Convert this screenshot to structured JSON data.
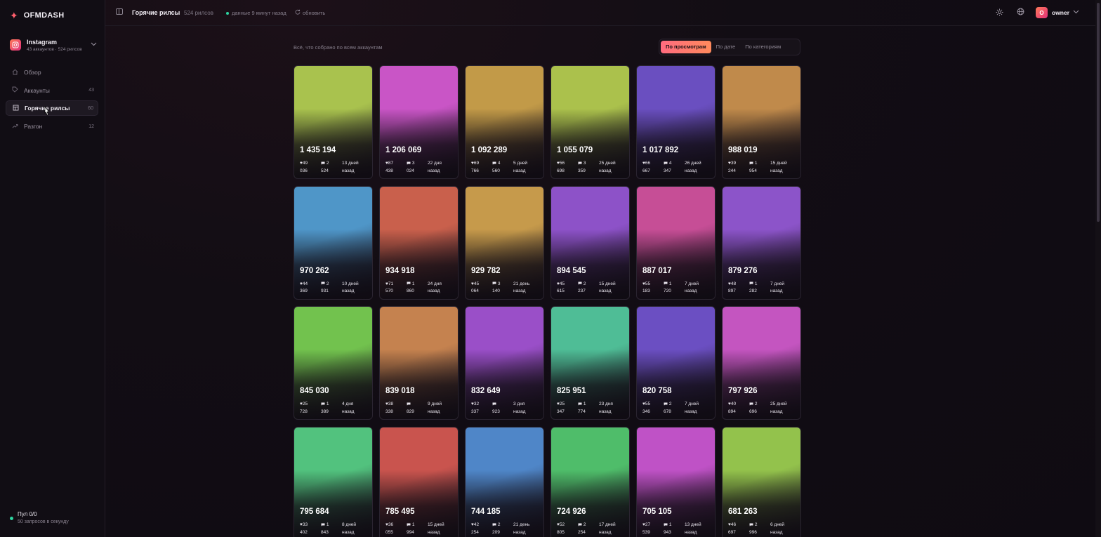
{
  "brand": {
    "name": "OFMDASH",
    "logo_icon": "sparkle-star-icon"
  },
  "platform": {
    "name": "Instagram",
    "subtitle": "43 аккаунтов · 524 рилсов",
    "icon": "instagram-icon"
  },
  "nav": [
    {
      "label": "Обзор",
      "count": "",
      "icon": "home-icon"
    },
    {
      "label": "Аккаунты",
      "count": "43",
      "icon": "tag-icon"
    },
    {
      "label": "Горячие рилсы",
      "count": "60",
      "icon": "grid-icon",
      "active": true
    },
    {
      "label": "Разгон",
      "count": "12",
      "icon": "trending-up-icon"
    }
  ],
  "pool": {
    "title": "Пул 0/0",
    "subtitle": "50 запросов в секунду"
  },
  "topbar": {
    "title": "Горячие рилсы",
    "count": "524 рилсов",
    "status": "данные 9 минут назад",
    "refresh": "обновить",
    "user": "owner",
    "avatar_letter": "O"
  },
  "subline": "Всё, что собрано по всем аккаунтам",
  "sort": {
    "options": [
      "По просмотрам",
      "По дате",
      "По категориям"
    ],
    "selected": "По просмотрам"
  },
  "cards": [
    {
      "views": "1 435 194",
      "likes": [
        "49",
        "036"
      ],
      "comments": [
        "2",
        "524"
      ],
      "age": [
        "13 дней",
        "назад"
      ],
      "color": "#a9c24e"
    },
    {
      "views": "1 206 069",
      "likes": [
        "87",
        "438"
      ],
      "comments": [
        "3",
        "024"
      ],
      "age": [
        "22 дня",
        "назад"
      ],
      "color": "#c955c6"
    },
    {
      "views": "1 092 289",
      "likes": [
        "69",
        "766"
      ],
      "comments": [
        "4",
        "560"
      ],
      "age": [
        "5 дней",
        "назад"
      ],
      "color": "#c29a48"
    },
    {
      "views": "1 055 079",
      "likes": [
        "56",
        "698"
      ],
      "comments": [
        "3",
        "359"
      ],
      "age": [
        "25 дней",
        "назад"
      ],
      "color": "#abc14c"
    },
    {
      "views": "1 017 892",
      "likes": [
        "66",
        "667"
      ],
      "comments": [
        "4",
        "347"
      ],
      "age": [
        "26 дней",
        "назад"
      ],
      "color": "#6a4fc0"
    },
    {
      "views": "988 019",
      "likes": [
        "39",
        "244"
      ],
      "comments": [
        "1",
        "954"
      ],
      "age": [
        "15 дней",
        "назад"
      ],
      "color": "#c08a4b"
    },
    {
      "views": "970 262",
      "likes": [
        "44",
        "369"
      ],
      "comments": [
        "2",
        "931"
      ],
      "age": [
        "10 дней",
        "назад"
      ],
      "color": "#4f96c8"
    },
    {
      "views": "934 918",
      "likes": [
        "71",
        "570"
      ],
      "comments": [
        "1",
        "860"
      ],
      "age": [
        "24 дня",
        "назад"
      ],
      "color": "#c9604c"
    },
    {
      "views": "929 782",
      "likes": [
        "45",
        "064"
      ],
      "comments": [
        "3",
        "140"
      ],
      "age": [
        "21 день",
        "назад"
      ],
      "color": "#c69a4b"
    },
    {
      "views": "894 545",
      "likes": [
        "45",
        "615"
      ],
      "comments": [
        "2",
        "237"
      ],
      "age": [
        "15 дней",
        "назад"
      ],
      "color": "#8d52c8"
    },
    {
      "views": "887 017",
      "likes": [
        "55",
        "183"
      ],
      "comments": [
        "1",
        "720"
      ],
      "age": [
        "7 дней",
        "назад"
      ],
      "color": "#c64e96"
    },
    {
      "views": "879 276",
      "likes": [
        "48",
        "897"
      ],
      "comments": [
        "1",
        "282"
      ],
      "age": [
        "7 дней",
        "назад"
      ],
      "color": "#8c54c9"
    },
    {
      "views": "845 030",
      "likes": [
        "25",
        "728"
      ],
      "comments": [
        "1",
        "389"
      ],
      "age": [
        "4 дня",
        "назад"
      ],
      "color": "#72c24e"
    },
    {
      "views": "839 018",
      "likes": [
        "38",
        "338"
      ],
      "comments": [
        "",
        "829"
      ],
      "age": [
        "9 дней",
        "назад"
      ],
      "color": "#c5824f"
    },
    {
      "views": "832 649",
      "likes": [
        "32",
        "337"
      ],
      "comments": [
        "",
        "923"
      ],
      "age": [
        "3 дня",
        "назад"
      ],
      "color": "#9a4fc8"
    },
    {
      "views": "825 951",
      "likes": [
        "25",
        "347"
      ],
      "comments": [
        "1",
        "774"
      ],
      "age": [
        "23 дня",
        "назад"
      ],
      "color": "#4fbd96"
    },
    {
      "views": "820 758",
      "likes": [
        "55",
        "346"
      ],
      "comments": [
        "2",
        "678"
      ],
      "age": [
        "7 дней",
        "назад"
      ],
      "color": "#6b4fc2"
    },
    {
      "views": "797 926",
      "likes": [
        "40",
        "894"
      ],
      "comments": [
        "2",
        "696"
      ],
      "age": [
        "25 дней",
        "назад"
      ],
      "color": "#c455c0"
    },
    {
      "views": "795 684",
      "likes": [
        "33",
        "402"
      ],
      "comments": [
        "1",
        "843"
      ],
      "age": [
        "8 дней",
        "назад"
      ],
      "color": "#52c27e"
    },
    {
      "views": "785 495",
      "likes": [
        "36",
        "055"
      ],
      "comments": [
        "1",
        "994"
      ],
      "age": [
        "15 дней",
        "назад"
      ],
      "color": "#c9544e"
    },
    {
      "views": "744 185",
      "likes": [
        "42",
        "254"
      ],
      "comments": [
        "2",
        "209"
      ],
      "age": [
        "21 день",
        "назад"
      ],
      "color": "#4f86c8"
    },
    {
      "views": "724 926",
      "likes": [
        "52",
        "805"
      ],
      "comments": [
        "2",
        "254"
      ],
      "age": [
        "17 дней",
        "назад"
      ],
      "color": "#4fbd6a"
    },
    {
      "views": "705 105",
      "likes": [
        "27",
        "539"
      ],
      "comments": [
        "1",
        "943"
      ],
      "age": [
        "13 дней",
        "назад"
      ],
      "color": "#bf52c6"
    },
    {
      "views": "681 263",
      "likes": [
        "46",
        "697"
      ],
      "comments": [
        "2",
        "996"
      ],
      "age": [
        "6 дней",
        "назад"
      ],
      "color": "#93c24c"
    }
  ]
}
